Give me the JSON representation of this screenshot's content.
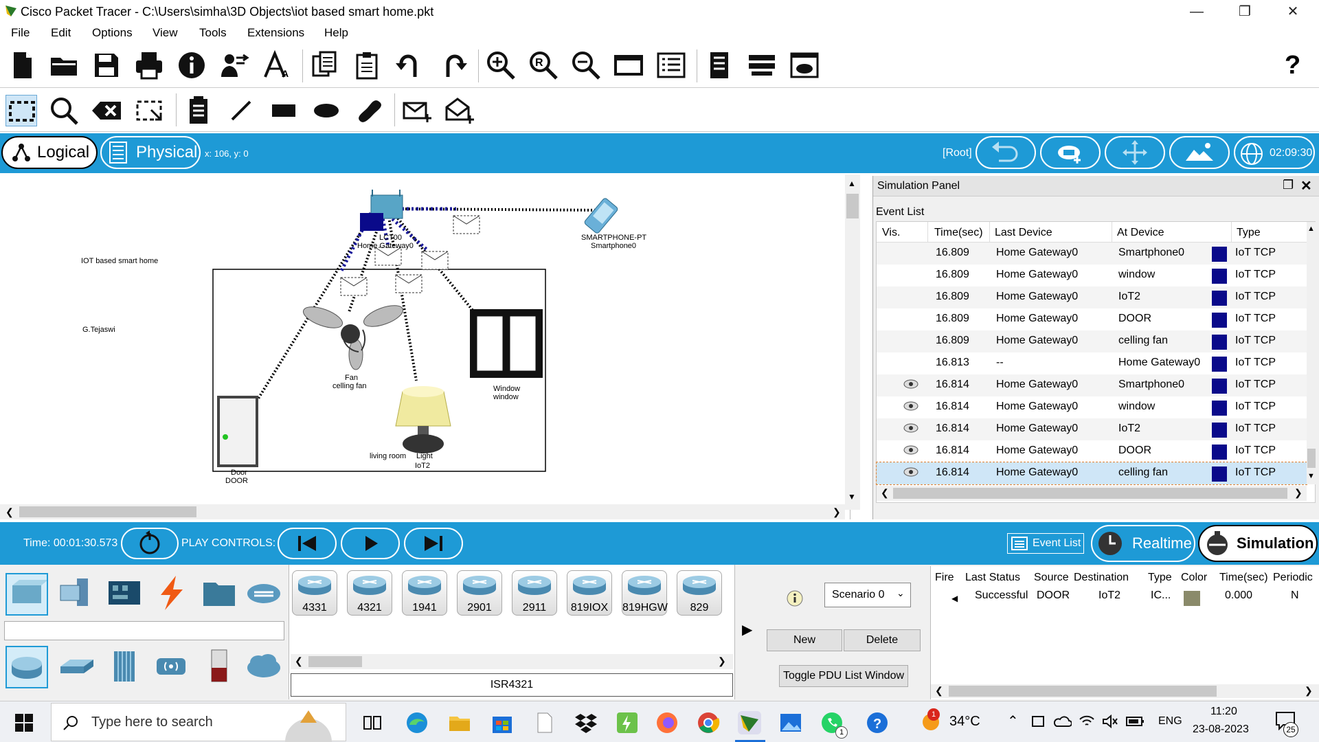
{
  "window": {
    "title": "Cisco Packet Tracer - C:\\Users\\simha\\3D Objects\\iot based smart home.pkt"
  },
  "menu": [
    "File",
    "Edit",
    "Options",
    "View",
    "Tools",
    "Extensions",
    "Help"
  ],
  "modes": {
    "logical": "Logical",
    "physical": "Physical",
    "coords": "x: 106, y: 0",
    "root": "[Root]",
    "clock": "02:09:30"
  },
  "workspace": {
    "note_title": "IOT based smart home",
    "note_author": "G.Tejaswi",
    "gateway_label_1": "LCT00",
    "gateway_label_2": "Home Gateway0",
    "smartphone_label_1": "SMARTPHONE-PT",
    "smartphone_label_2": "Smartphone0",
    "fan_label_1": "Fan",
    "fan_label_2": "celling fan",
    "window_label_1": "Window",
    "window_label_2": "window",
    "door_label_1": "Door",
    "door_label_2": "DOOR",
    "light_label_1": "Light",
    "light_label_2": "IoT2",
    "room_label": "living room"
  },
  "sim_panel": {
    "title": "Simulation Panel",
    "event_list_label": "Event List",
    "columns": [
      "Vis.",
      "Time(sec)",
      "Last Device",
      "At Device",
      "Type"
    ],
    "events": [
      {
        "vis": false,
        "time": "16.809",
        "last": "Home Gateway0",
        "at": "Smartphone0",
        "type": "IoT TCP"
      },
      {
        "vis": false,
        "time": "16.809",
        "last": "Home Gateway0",
        "at": "window",
        "type": "IoT TCP"
      },
      {
        "vis": false,
        "time": "16.809",
        "last": "Home Gateway0",
        "at": "IoT2",
        "type": "IoT TCP"
      },
      {
        "vis": false,
        "time": "16.809",
        "last": "Home Gateway0",
        "at": "DOOR",
        "type": "IoT TCP"
      },
      {
        "vis": false,
        "time": "16.809",
        "last": "Home Gateway0",
        "at": "celling fan",
        "type": "IoT TCP"
      },
      {
        "vis": false,
        "time": "16.813",
        "last": "--",
        "at": "Home Gateway0",
        "type": "IoT TCP"
      },
      {
        "vis": true,
        "time": "16.814",
        "last": "Home Gateway0",
        "at": "Smartphone0",
        "type": "IoT TCP"
      },
      {
        "vis": true,
        "time": "16.814",
        "last": "Home Gateway0",
        "at": "window",
        "type": "IoT TCP"
      },
      {
        "vis": true,
        "time": "16.814",
        "last": "Home Gateway0",
        "at": "IoT2",
        "type": "IoT TCP"
      },
      {
        "vis": true,
        "time": "16.814",
        "last": "Home Gateway0",
        "at": "DOOR",
        "type": "IoT TCP"
      },
      {
        "vis": true,
        "time": "16.814",
        "last": "Home Gateway0",
        "at": "celling fan",
        "type": "IoT TCP",
        "selected": true
      }
    ]
  },
  "controls": {
    "time": "Time: 00:01:30.573",
    "play_label": "PLAY CONTROLS:",
    "event_list_btn": "Event List",
    "realtime": "Realtime",
    "simulation": "Simulation"
  },
  "devices": {
    "routers": [
      "4331",
      "4321",
      "1941",
      "2901",
      "2911",
      "819IOX",
      "819HGW",
      "829"
    ],
    "selected_model": "ISR4321"
  },
  "scenario": {
    "selected": "Scenario 0",
    "new_btn": "New",
    "delete_btn": "Delete",
    "toggle_btn": "Toggle PDU List Window"
  },
  "pdu": {
    "columns": [
      "Fire",
      "Last Status",
      "Source",
      "Destination",
      "Type",
      "Color",
      "Time(sec)",
      "Periodic"
    ],
    "row": {
      "status": "Successful",
      "source": "DOOR",
      "dest": "IoT2",
      "type": "IC...",
      "time": "0.000",
      "periodic": "N",
      "color": "#8a8a6a"
    }
  },
  "taskbar": {
    "search_placeholder": "Type here to search",
    "temp": "34°C",
    "lang": "ENG",
    "time": "11:20",
    "date": "23-08-2023",
    "notif_count": "25",
    "weather_badge": "1",
    "whatsapp_badge": "1"
  }
}
